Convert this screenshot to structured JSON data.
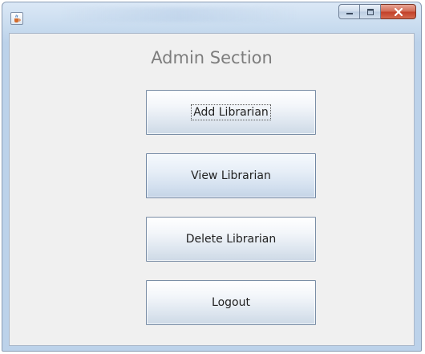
{
  "window": {
    "minimize_glyph": "–",
    "maximize_glyph": "□",
    "close_glyph": "x"
  },
  "heading": "Admin Section",
  "buttons": [
    {
      "label": "Add Librarian",
      "focused": true
    },
    {
      "label": "View Librarian",
      "focused": false
    },
    {
      "label": "Delete Librarian",
      "focused": false
    },
    {
      "label": "Logout",
      "focused": false
    }
  ],
  "colors": {
    "client_background": "#f0f0f0",
    "heading_text": "#7d7d7d",
    "close_button": "#c2412a"
  },
  "icons": {
    "app": "java-cup-icon",
    "minimize": "minimize-icon",
    "maximize": "maximize-icon",
    "close": "close-icon"
  }
}
